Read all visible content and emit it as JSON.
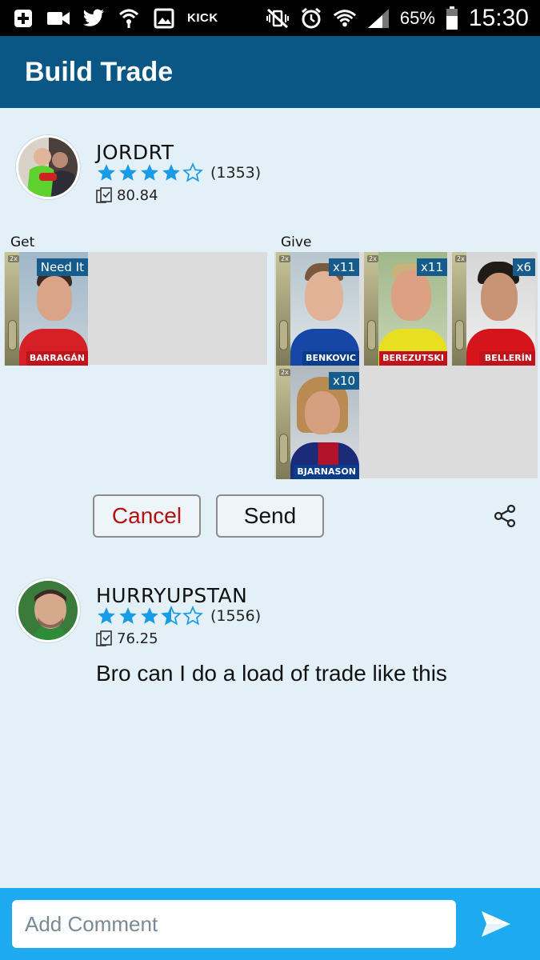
{
  "statusbar": {
    "kick_label": "KICK",
    "battery": "65%",
    "time": "15:30"
  },
  "appbar": {
    "title": "Build Trade"
  },
  "trade": {
    "user": {
      "name": "JORDRT",
      "rating": 4,
      "rating_count": "(1353)",
      "score": "80.84"
    },
    "get_label": "Get",
    "give_label": "Give",
    "get_cards": [
      {
        "name": "BARRAGÁN",
        "badge": "Need It"
      }
    ],
    "give_cards": [
      {
        "name": "BENKOVIC",
        "badge": "x11"
      },
      {
        "name": "BEREZUTSKI",
        "badge": "x11"
      },
      {
        "name": "BELLERÍN",
        "badge": "x6"
      },
      {
        "name": "BJARNASON",
        "badge": "x10"
      }
    ],
    "cancel_label": "Cancel",
    "send_label": "Send"
  },
  "comment": {
    "user": {
      "name": "HURRYUPSTAN",
      "rating": 3.5,
      "rating_count": "(1556)",
      "score": "76.25"
    },
    "text": "Bro can I do a load of trade like this"
  },
  "input": {
    "placeholder": "Add Comment"
  },
  "colors": {
    "appbar": "#0a5786",
    "accent": "#1eaaf1",
    "star": "#1a9be6",
    "cancel": "#b31212"
  }
}
